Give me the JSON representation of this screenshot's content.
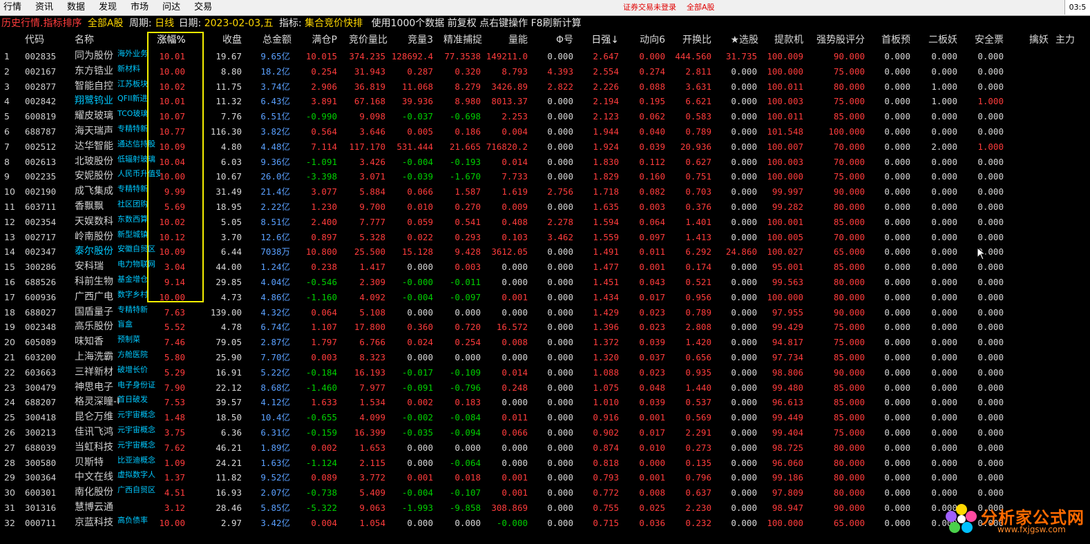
{
  "menu": [
    "行情",
    "资讯",
    "数据",
    "发现",
    "市场",
    "问达",
    "交易"
  ],
  "status_right": {
    "login": "证券交易未登录",
    "board": "全部A股"
  },
  "clock": "03:5",
  "info": {
    "mode": "历史行情.指标排序",
    "board": "全部A股",
    "period_label": "周期:",
    "period": "日线",
    "date_label": "日期:",
    "date": "2023-02-03,五",
    "indicator_label": "指标:",
    "indicator": "集合竞价快排",
    "note": "使用1000个数据 前复权 点右键操作 F8刷新计算"
  },
  "headers": [
    "代码",
    "名称",
    "涨幅%",
    "收盘",
    "总金额",
    "满仓P",
    "竞价量比",
    "竞量3",
    "精准捕捉",
    "量能",
    "Φ号",
    "日强↓",
    "动向6",
    "开换比",
    "★选股",
    "提款机",
    "强势股评分",
    "首板预",
    "二板妖",
    "安全票",
    "擒妖",
    "主力"
  ],
  "rows": [
    [
      "1",
      "002835",
      "同为股份",
      "海外业务",
      "10.01",
      "19.67",
      "9.65亿",
      "10.015",
      "374.235",
      "128692.4",
      "77.3538",
      "149211.0",
      "0.000",
      "2.647",
      "0.000",
      "444.560",
      "31.735",
      "100.009",
      "90.000",
      "0.000",
      "0.000",
      "0.000"
    ],
    [
      "2",
      "002167",
      "东方锆业",
      "新材料",
      "10.00",
      "8.80",
      "18.2亿",
      "0.254",
      "31.943",
      "0.287",
      "0.320",
      "8.793",
      "4.393",
      "2.554",
      "0.274",
      "2.811",
      "0.000",
      "100.000",
      "75.000",
      "0.000",
      "0.000",
      "0.000"
    ],
    [
      "3",
      "002877",
      "智能自控",
      "江苏板块",
      "10.02",
      "11.75",
      "3.74亿",
      "2.906",
      "36.819",
      "11.068",
      "8.279",
      "3426.89",
      "2.822",
      "2.226",
      "0.088",
      "3.631",
      "0.000",
      "100.011",
      "80.000",
      "0.000",
      "1.000",
      "0.000"
    ],
    [
      "4",
      "002842",
      "翔鹭钨业",
      "QFII新进",
      "10.01",
      "11.32",
      "6.43亿",
      "3.891",
      "67.168",
      "39.936",
      "8.980",
      "8013.37",
      "0.000",
      "2.194",
      "0.195",
      "6.621",
      "0.000",
      "100.003",
      "75.000",
      "0.000",
      "1.000",
      "1.000"
    ],
    [
      "5",
      "600819",
      "耀皮玻璃",
      "TCO玻璃",
      "10.07",
      "7.76",
      "6.51亿",
      "-0.990",
      "9.098",
      "-0.037",
      "-0.698",
      "2.253",
      "0.000",
      "2.123",
      "0.062",
      "0.583",
      "0.000",
      "100.011",
      "85.000",
      "0.000",
      "0.000",
      "0.000"
    ],
    [
      "6",
      "688787",
      "海天瑞声",
      "专精特新",
      "10.77",
      "116.30",
      "3.82亿",
      "0.564",
      "3.646",
      "0.005",
      "0.186",
      "0.004",
      "0.000",
      "1.944",
      "0.040",
      "0.789",
      "0.000",
      "101.548",
      "100.000",
      "0.000",
      "0.000",
      "0.000"
    ],
    [
      "7",
      "002512",
      "达华智能",
      "通达信持股",
      "10.09",
      "4.80",
      "4.48亿",
      "7.114",
      "117.170",
      "531.444",
      "21.665",
      "716820.2",
      "0.000",
      "1.924",
      "0.039",
      "20.936",
      "0.000",
      "100.007",
      "70.000",
      "0.000",
      "2.000",
      "1.000"
    ],
    [
      "8",
      "002613",
      "北玻股份",
      "低辐射玻璃",
      "10.04",
      "6.03",
      "9.36亿",
      "-1.091",
      "3.426",
      "-0.004",
      "-0.193",
      "0.014",
      "0.000",
      "1.830",
      "0.112",
      "0.627",
      "0.000",
      "100.003",
      "70.000",
      "0.000",
      "0.000",
      "0.000"
    ],
    [
      "9",
      "002235",
      "安妮股份",
      "人民币升值受益",
      "10.00",
      "10.67",
      "26.0亿",
      "-3.398",
      "3.071",
      "-0.039",
      "-1.670",
      "7.733",
      "0.000",
      "1.829",
      "0.160",
      "0.751",
      "0.000",
      "100.000",
      "75.000",
      "0.000",
      "0.000",
      "0.000"
    ],
    [
      "10",
      "002190",
      "成飞集成",
      "专精特新",
      "9.99",
      "31.49",
      "21.4亿",
      "3.077",
      "5.884",
      "0.066",
      "1.587",
      "1.619",
      "2.756",
      "1.718",
      "0.082",
      "0.703",
      "0.000",
      "99.997",
      "90.000",
      "0.000",
      "0.000",
      "0.000"
    ],
    [
      "11",
      "603711",
      "香飘飘",
      "社区团购",
      "5.69",
      "18.95",
      "2.22亿",
      "1.230",
      "9.700",
      "0.010",
      "0.270",
      "0.009",
      "0.000",
      "1.635",
      "0.003",
      "0.376",
      "0.000",
      "99.282",
      "80.000",
      "0.000",
      "0.000",
      "0.000"
    ],
    [
      "12",
      "002354",
      "天娱数科",
      "东数西算",
      "10.02",
      "5.05",
      "8.51亿",
      "2.400",
      "7.777",
      "0.059",
      "0.541",
      "0.408",
      "2.278",
      "1.594",
      "0.064",
      "1.401",
      "0.000",
      "100.001",
      "85.000",
      "0.000",
      "0.000",
      "0.000"
    ],
    [
      "13",
      "002717",
      "岭南股份",
      "新型城镇",
      "10.12",
      "3.70",
      "12.6亿",
      "0.897",
      "5.328",
      "0.022",
      "0.293",
      "0.103",
      "3.462",
      "1.559",
      "0.097",
      "1.413",
      "0.000",
      "100.005",
      "70.000",
      "0.000",
      "0.000",
      "0.000"
    ],
    [
      "14",
      "002347",
      "泰尔股份",
      "安徽自贸区",
      "10.09",
      "6.44",
      "7038万",
      "10.800",
      "25.500",
      "15.128",
      "9.428",
      "3612.05",
      "0.000",
      "1.491",
      "0.011",
      "6.292",
      "24.860",
      "100.027",
      "65.000",
      "0.000",
      "0.000",
      "0.000"
    ],
    [
      "15",
      "300286",
      "安科瑞",
      "电力物联网",
      "3.04",
      "44.00",
      "1.24亿",
      "0.238",
      "1.417",
      "0.000",
      "0.003",
      "0.000",
      "0.000",
      "1.477",
      "0.001",
      "0.174",
      "0.000",
      "95.001",
      "85.000",
      "0.000",
      "0.000",
      "0.000"
    ],
    [
      "16",
      "688526",
      "科前生物",
      "基金增仓",
      "9.14",
      "29.85",
      "4.04亿",
      "-0.546",
      "2.309",
      "-0.000",
      "-0.011",
      "0.000",
      "0.000",
      "1.451",
      "0.043",
      "0.521",
      "0.000",
      "99.563",
      "80.000",
      "0.000",
      "0.000",
      "0.000"
    ],
    [
      "17",
      "600936",
      "广西广电",
      "数字乡村",
      "10.00",
      "4.73",
      "4.86亿",
      "-1.160",
      "4.092",
      "-0.004",
      "-0.097",
      "0.001",
      "0.000",
      "1.434",
      "0.017",
      "0.956",
      "0.000",
      "100.000",
      "80.000",
      "0.000",
      "0.000",
      "0.000"
    ],
    [
      "18",
      "688027",
      "国盾量子",
      "专精特新",
      "7.63",
      "139.00",
      "4.32亿",
      "0.064",
      "5.108",
      "0.000",
      "0.000",
      "0.000",
      "0.000",
      "1.429",
      "0.023",
      "0.789",
      "0.000",
      "97.955",
      "90.000",
      "0.000",
      "0.000",
      "0.000"
    ],
    [
      "19",
      "002348",
      "高乐股份",
      "盲盒",
      "5.52",
      "4.78",
      "6.74亿",
      "1.107",
      "17.800",
      "0.360",
      "0.720",
      "16.572",
      "0.000",
      "1.396",
      "0.023",
      "2.808",
      "0.000",
      "99.429",
      "75.000",
      "0.000",
      "0.000",
      "0.000"
    ],
    [
      "20",
      "605089",
      "味知香",
      "预制菜",
      "7.46",
      "79.05",
      "2.87亿",
      "1.797",
      "6.766",
      "0.024",
      "0.254",
      "0.008",
      "0.000",
      "1.372",
      "0.039",
      "1.420",
      "0.000",
      "94.817",
      "75.000",
      "0.000",
      "0.000",
      "0.000"
    ],
    [
      "21",
      "603200",
      "上海洗霸",
      "方舱医院",
      "5.80",
      "25.90",
      "7.70亿",
      "0.003",
      "8.323",
      "0.000",
      "0.000",
      "0.000",
      "0.000",
      "1.320",
      "0.037",
      "0.656",
      "0.000",
      "97.734",
      "85.000",
      "0.000",
      "0.000",
      "0.000"
    ],
    [
      "22",
      "603663",
      "三祥新材",
      "破增长价",
      "5.29",
      "16.91",
      "5.22亿",
      "-0.184",
      "16.193",
      "-0.017",
      "-0.109",
      "0.014",
      "0.000",
      "1.088",
      "0.023",
      "0.935",
      "0.000",
      "98.806",
      "90.000",
      "0.000",
      "0.000",
      "0.000"
    ],
    [
      "23",
      "300479",
      "神思电子",
      "电子身份证",
      "7.90",
      "22.12",
      "8.68亿",
      "-1.460",
      "7.977",
      "-0.091",
      "-0.796",
      "0.248",
      "0.000",
      "1.075",
      "0.048",
      "1.440",
      "0.000",
      "99.480",
      "85.000",
      "0.000",
      "0.000",
      "0.000"
    ],
    [
      "24",
      "688207",
      "格灵深瞳-U",
      "首日破发",
      "7.53",
      "39.57",
      "4.12亿",
      "1.633",
      "1.534",
      "0.002",
      "0.183",
      "0.000",
      "0.000",
      "1.010",
      "0.039",
      "0.537",
      "0.000",
      "96.613",
      "85.000",
      "0.000",
      "0.000",
      "0.000"
    ],
    [
      "25",
      "300418",
      "昆仑万维",
      "元宇宙概念",
      "1.48",
      "18.50",
      "10.4亿",
      "-0.655",
      "4.099",
      "-0.002",
      "-0.084",
      "0.011",
      "0.000",
      "0.916",
      "0.001",
      "0.569",
      "0.000",
      "99.449",
      "85.000",
      "0.000",
      "0.000",
      "0.000"
    ],
    [
      "26",
      "300213",
      "佳讯飞鸿",
      "元宇宙概念",
      "3.75",
      "6.36",
      "6.31亿",
      "-0.159",
      "16.399",
      "-0.035",
      "-0.094",
      "0.066",
      "0.000",
      "0.902",
      "0.017",
      "2.291",
      "0.000",
      "99.404",
      "75.000",
      "0.000",
      "0.000",
      "0.000"
    ],
    [
      "27",
      "688039",
      "当虹科技",
      "元宇宙概念",
      "7.62",
      "46.21",
      "1.89亿",
      "0.002",
      "1.653",
      "0.000",
      "0.000",
      "0.000",
      "0.000",
      "0.874",
      "0.010",
      "0.273",
      "0.000",
      "98.725",
      "80.000",
      "0.000",
      "0.000",
      "0.000"
    ],
    [
      "28",
      "300580",
      "贝斯特",
      "比亚迪概念",
      "1.09",
      "24.21",
      "1.63亿",
      "-1.124",
      "2.115",
      "0.000",
      "-0.064",
      "0.000",
      "0.000",
      "0.818",
      "0.000",
      "0.135",
      "0.000",
      "96.060",
      "80.000",
      "0.000",
      "0.000",
      "0.000"
    ],
    [
      "29",
      "300364",
      "中文在线",
      "虚拟数字人",
      "1.37",
      "11.82",
      "9.52亿",
      "0.089",
      "3.772",
      "0.001",
      "0.018",
      "0.001",
      "0.000",
      "0.793",
      "0.001",
      "0.796",
      "0.000",
      "99.186",
      "80.000",
      "0.000",
      "0.000",
      "0.000"
    ],
    [
      "30",
      "600301",
      "南化股份",
      "广西自贸区",
      "4.51",
      "16.93",
      "2.07亿",
      "-0.738",
      "5.409",
      "-0.004",
      "-0.107",
      "0.001",
      "0.000",
      "0.772",
      "0.008",
      "0.637",
      "0.000",
      "97.809",
      "80.000",
      "0.000",
      "0.000",
      "0.000"
    ],
    [
      "31",
      "301316",
      "慧博云通",
      "",
      "3.12",
      "28.46",
      "5.85亿",
      "-5.322",
      "9.063",
      "-1.993",
      "-9.858",
      "308.869",
      "0.000",
      "0.755",
      "0.025",
      "2.230",
      "0.000",
      "98.947",
      "90.000",
      "0.000",
      "0.000",
      "0.000"
    ],
    [
      "32",
      "000711",
      "京蓝科技",
      "高负债率",
      "10.00",
      "2.97",
      "3.42亿",
      "0.004",
      "1.054",
      "0.000",
      "0.000",
      "-0.000",
      "0.000",
      "0.715",
      "0.036",
      "0.232",
      "0.000",
      "100.000",
      "65.000",
      "0.000",
      "0.000",
      "0.000"
    ]
  ],
  "watermark": {
    "title": "分析家公式网",
    "url": "www.fxjgsw.com"
  }
}
